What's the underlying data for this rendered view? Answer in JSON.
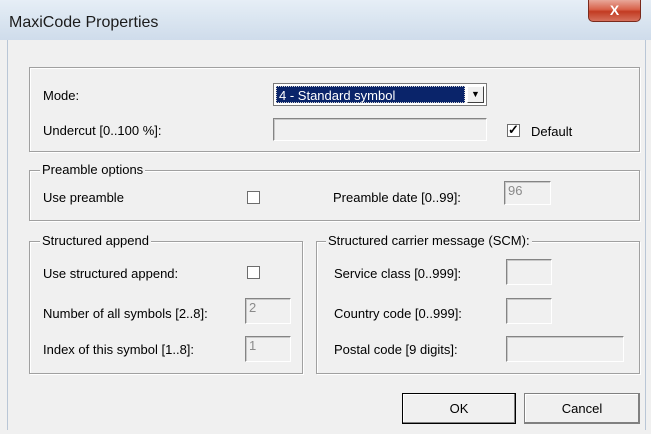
{
  "window": {
    "title": "MaxiCode Properties",
    "close_glyph": "X"
  },
  "mode": {
    "label": "Mode:",
    "value": "4 - Standard symbol",
    "dropdown_icon": "chevron-down-icon"
  },
  "undercut": {
    "label": "Undercut [0..100 %]:",
    "value": "",
    "default_checked": true,
    "default_label": "Default"
  },
  "preamble": {
    "group_label": "Preamble options",
    "use_label": "Use preamble",
    "use_checked": false,
    "date_label": "Preamble date [0..99]:",
    "date_value": "96"
  },
  "structured_append": {
    "group_label": "Structured append",
    "use_label": "Use structured append:",
    "use_checked": false,
    "count_label": "Number of all symbols [2..8]:",
    "count_value": "2",
    "index_label": "Index of this symbol [1..8]:",
    "index_value": "1"
  },
  "scm": {
    "group_label": "Structured carrier message (SCM):",
    "service_label": "Service class [0..999]:",
    "service_value": "",
    "country_label": "Country code [0..999]:",
    "country_value": "",
    "postal_label": "Postal code [9 digits]:",
    "postal_value": ""
  },
  "buttons": {
    "ok": "OK",
    "cancel": "Cancel"
  },
  "colors": {
    "selection": "#0a246a",
    "close_button": "#c23b22",
    "dialog_bg": "#f0f0f0"
  }
}
